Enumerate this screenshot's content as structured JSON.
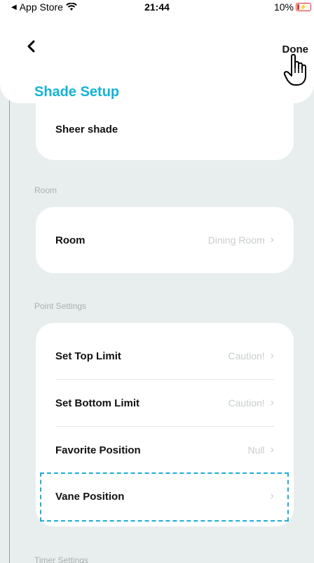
{
  "status_bar": {
    "carrier": "App Store",
    "time": "21:44",
    "battery": "10%"
  },
  "header": {
    "done_label": "Done",
    "title": "Shade Setup"
  },
  "shade_type": {
    "label": "Sheer shade"
  },
  "room_section": {
    "title": "Room",
    "row_label": "Room",
    "row_value": "Dining Room"
  },
  "point_settings": {
    "title": "Point Settings",
    "rows": [
      {
        "label": "Set Top Limit",
        "value": "Caution!"
      },
      {
        "label": "Set Bottom Limit",
        "value": "Caution!"
      },
      {
        "label": "Favorite Position",
        "value": "Null"
      },
      {
        "label": "Vane Position",
        "value": ""
      }
    ]
  },
  "timer_settings": {
    "title": "Timer Settings"
  },
  "colors": {
    "accent": "#15b3d6",
    "background": "#e8eeee",
    "highlight_dash": "#20acd4"
  }
}
